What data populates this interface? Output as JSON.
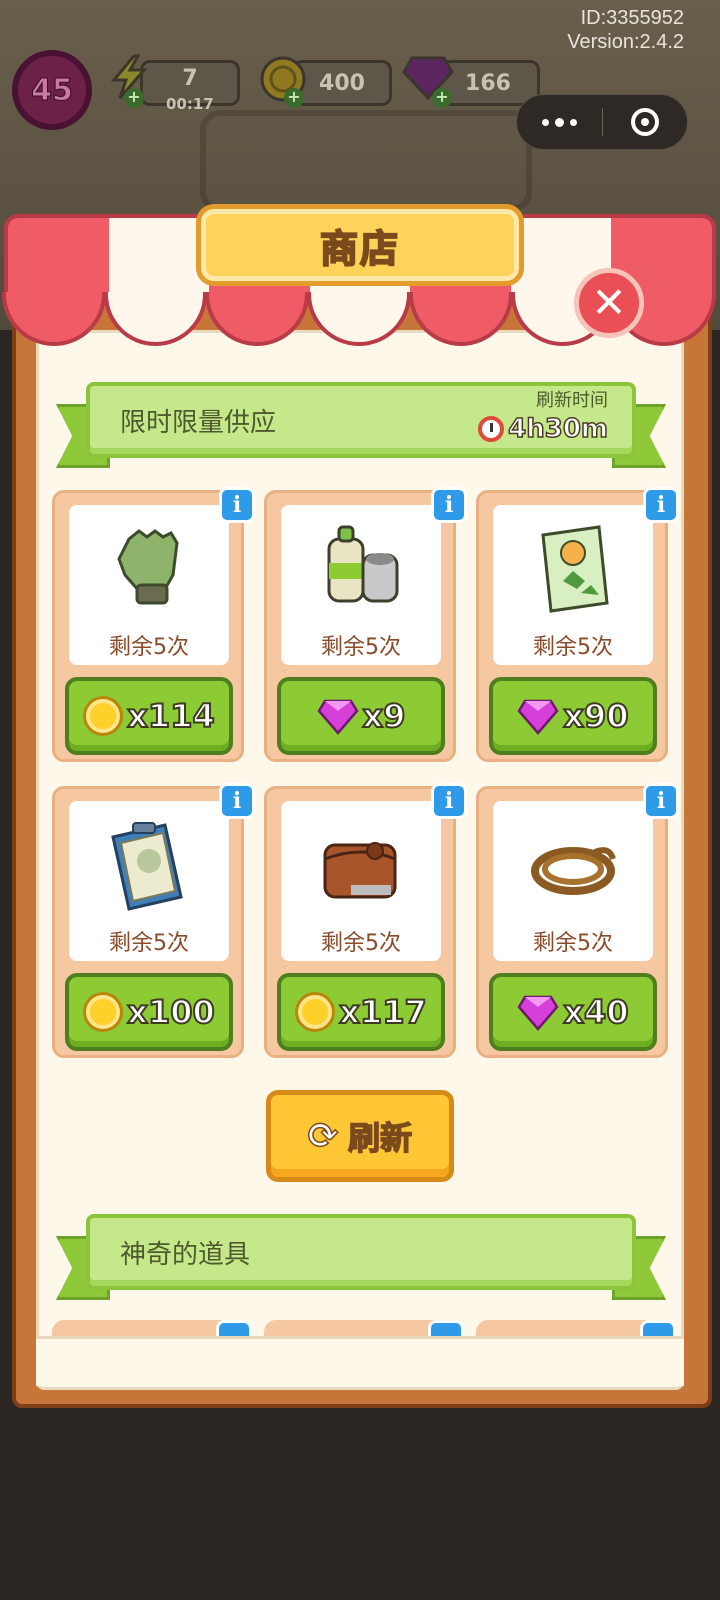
{
  "header": {
    "id_text": "ID:3355952",
    "version_text": "Version:2.4.2"
  },
  "hud": {
    "level": "45",
    "energy": "7",
    "energy_timer": "00:17",
    "coins": "400",
    "gems": "166",
    "add_symbol": "+"
  },
  "colors": {
    "panel_wood": "#c8753a",
    "awning_red": "#f05c66",
    "ribbon_green": "#c5e88a",
    "buy_green": "#8ccb33",
    "refresh_yellow": "#ffc636",
    "info_blue": "#2f9be8"
  },
  "shop": {
    "title": "商店",
    "close_symbol": "✕",
    "section1": {
      "title": "限时限量供应",
      "refresh_caption": "刷新时间",
      "refresh_time": "4h30m"
    },
    "items": [
      {
        "icon": "glove-icon",
        "remaining": "剩余5次",
        "currency": "coin",
        "price": "x114"
      },
      {
        "icon": "spray-bottles-icon",
        "remaining": "剩余5次",
        "currency": "gem",
        "price": "x9"
      },
      {
        "icon": "seed-packet-icon",
        "remaining": "剩余5次",
        "currency": "gem",
        "price": "x90"
      },
      {
        "icon": "clipboard-icon",
        "remaining": "剩余5次",
        "currency": "coin",
        "price": "x100"
      },
      {
        "icon": "wallet-icon",
        "remaining": "剩余5次",
        "currency": "coin",
        "price": "x117"
      },
      {
        "icon": "rope-icon",
        "remaining": "剩余5次",
        "currency": "gem",
        "price": "x40"
      }
    ],
    "info_symbol": "i",
    "refresh_button": "刷新",
    "section2": {
      "title": "神奇的道具"
    }
  }
}
